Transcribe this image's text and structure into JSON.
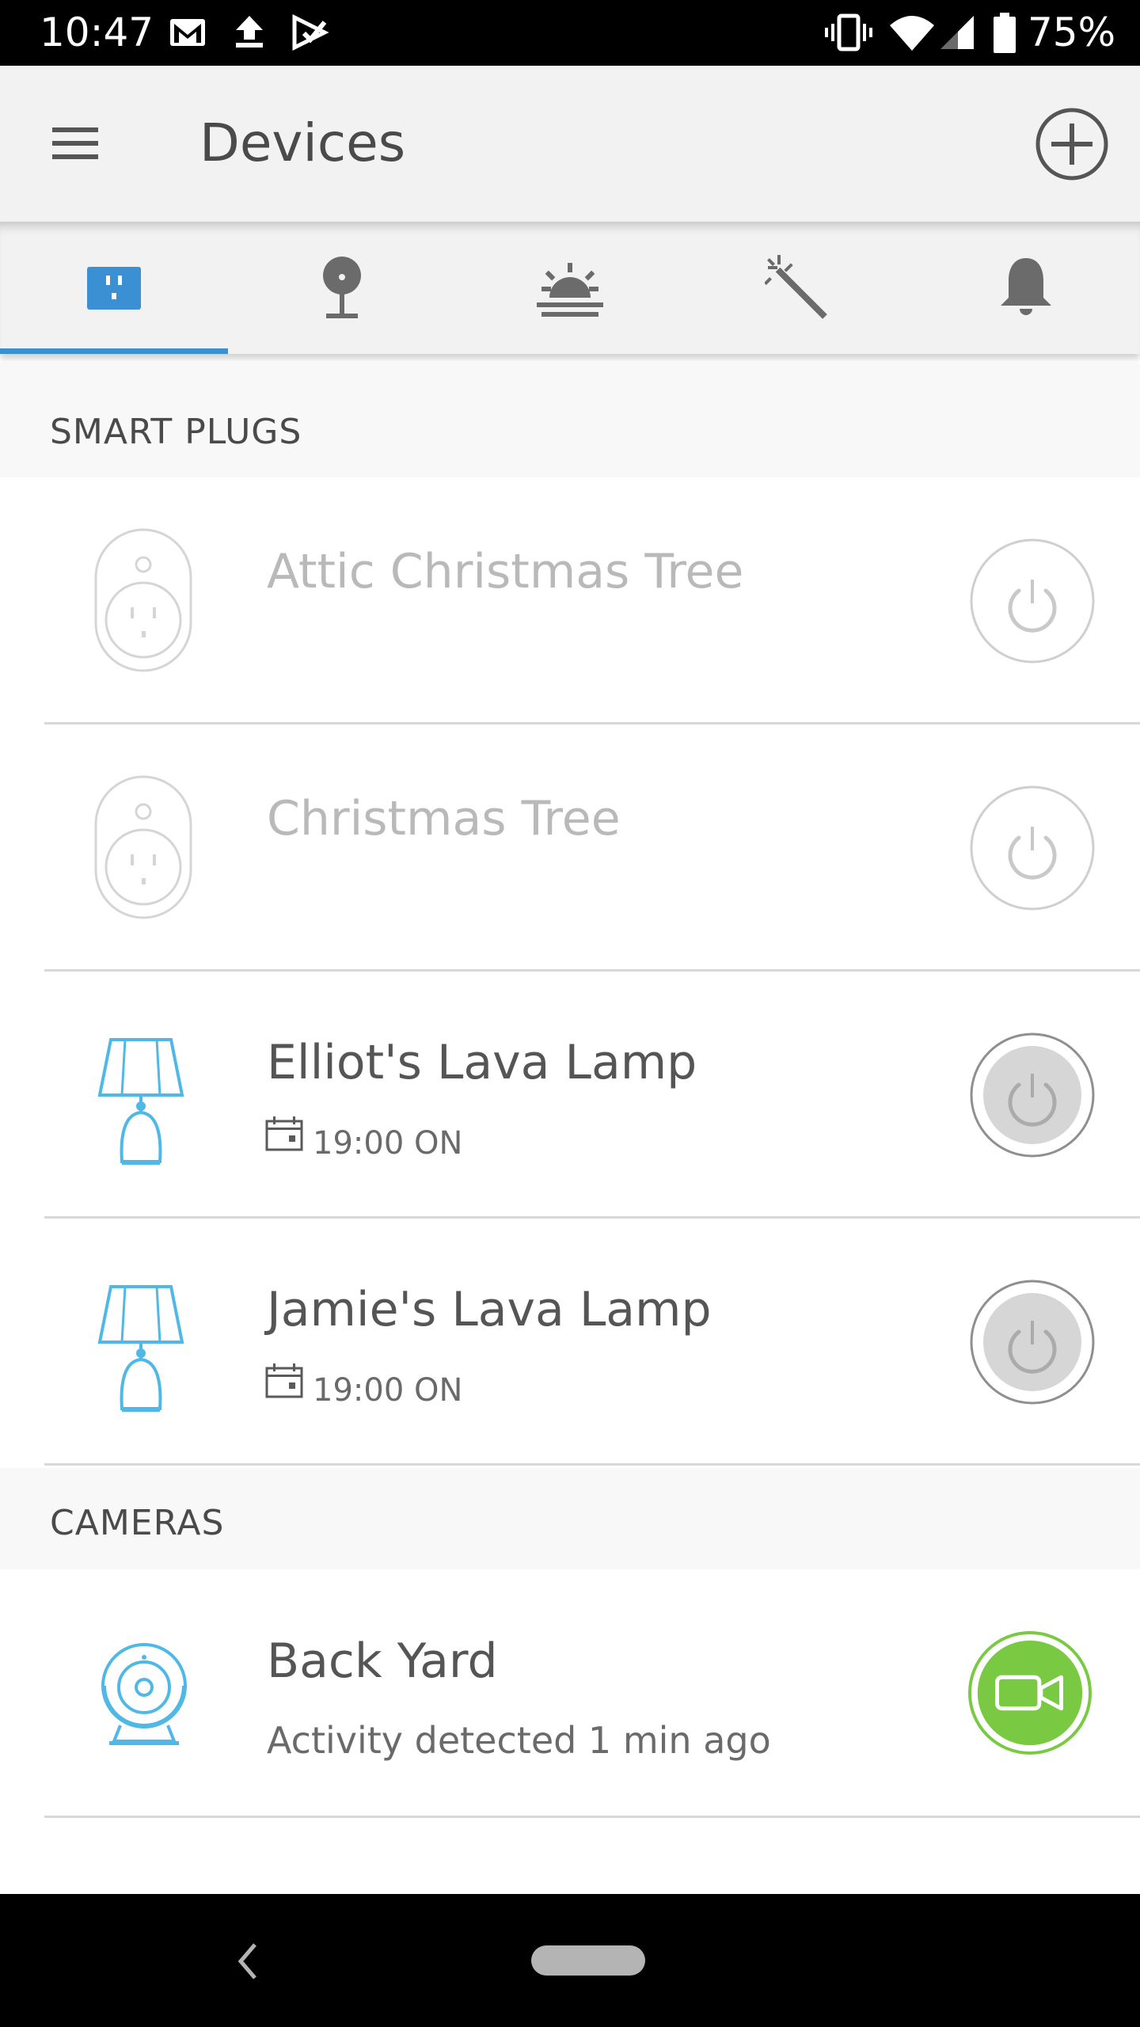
{
  "status_bar": {
    "time": "10:47",
    "battery_percent": "75%",
    "icons": [
      "gmail-icon",
      "upload-icon",
      "play-store-icon",
      "vibrate-icon",
      "wifi-icon",
      "cell-signal-icon",
      "battery-icon"
    ]
  },
  "header": {
    "title": "Devices",
    "menu_icon": "hamburger-menu-icon",
    "add_icon": "add-circle-icon"
  },
  "tabs": [
    {
      "name": "smart-plugs",
      "icon": "smart-plug-icon",
      "active": true
    },
    {
      "name": "bulbs",
      "icon": "bulb-icon",
      "active": false
    },
    {
      "name": "scenes",
      "icon": "sunrise-icon",
      "active": false
    },
    {
      "name": "magic",
      "icon": "magic-wand-icon",
      "active": false
    },
    {
      "name": "notifications",
      "icon": "bell-icon",
      "active": false
    }
  ],
  "sections": {
    "smart_plugs": {
      "title": "SMART PLUGS",
      "devices": [
        {
          "name": "Attic Christmas Tree",
          "icon": "smart-plug-icon",
          "state": "offline",
          "schedule": ""
        },
        {
          "name": "Christmas Tree",
          "icon": "smart-plug-icon",
          "state": "offline",
          "schedule": ""
        },
        {
          "name": "Elliot's Lava Lamp",
          "icon": "lamp-icon",
          "state": "off",
          "schedule": "19:00 ON"
        },
        {
          "name": "Jamie's Lava Lamp",
          "icon": "lamp-icon",
          "state": "off",
          "schedule": "19:00 ON"
        }
      ]
    },
    "cameras": {
      "title": "CAMERAS",
      "devices": [
        {
          "name": "Back Yard",
          "icon": "camera-icon",
          "status": "Activity detected 1 min ago"
        }
      ]
    }
  },
  "colors": {
    "accent": "#3a90d3",
    "lamp_icon": "#4fb8e6",
    "camera_live": "#7ac943",
    "offline_text": "#b9b9b9"
  },
  "nav_bar": {
    "icons": [
      "back-icon",
      "home-pill-icon"
    ]
  }
}
